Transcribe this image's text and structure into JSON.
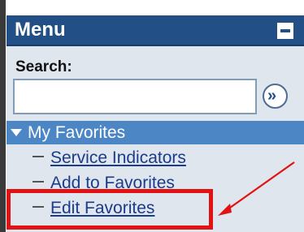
{
  "menu": {
    "title": "Menu",
    "collapse_icon": "minus-icon"
  },
  "search": {
    "label": "Search:",
    "value": "",
    "placeholder": "",
    "go_icon": "double-chevron-right-icon",
    "go_glyph": "»"
  },
  "favorites": {
    "section_label": "My Favorites",
    "expand_icon": "triangle-down-icon",
    "items": [
      {
        "label": "Service Indicators"
      },
      {
        "label": "Add to Favorites"
      },
      {
        "label": "Edit Favorites"
      }
    ]
  },
  "annotation": {
    "highlight_color": "#e21212",
    "arrow_color": "#e21212"
  },
  "colors": {
    "header_bg": "#214f86",
    "panel_bg": "#dfe6ee",
    "favorites_bg": "#4d86c5",
    "link": "#1b3b8b"
  }
}
